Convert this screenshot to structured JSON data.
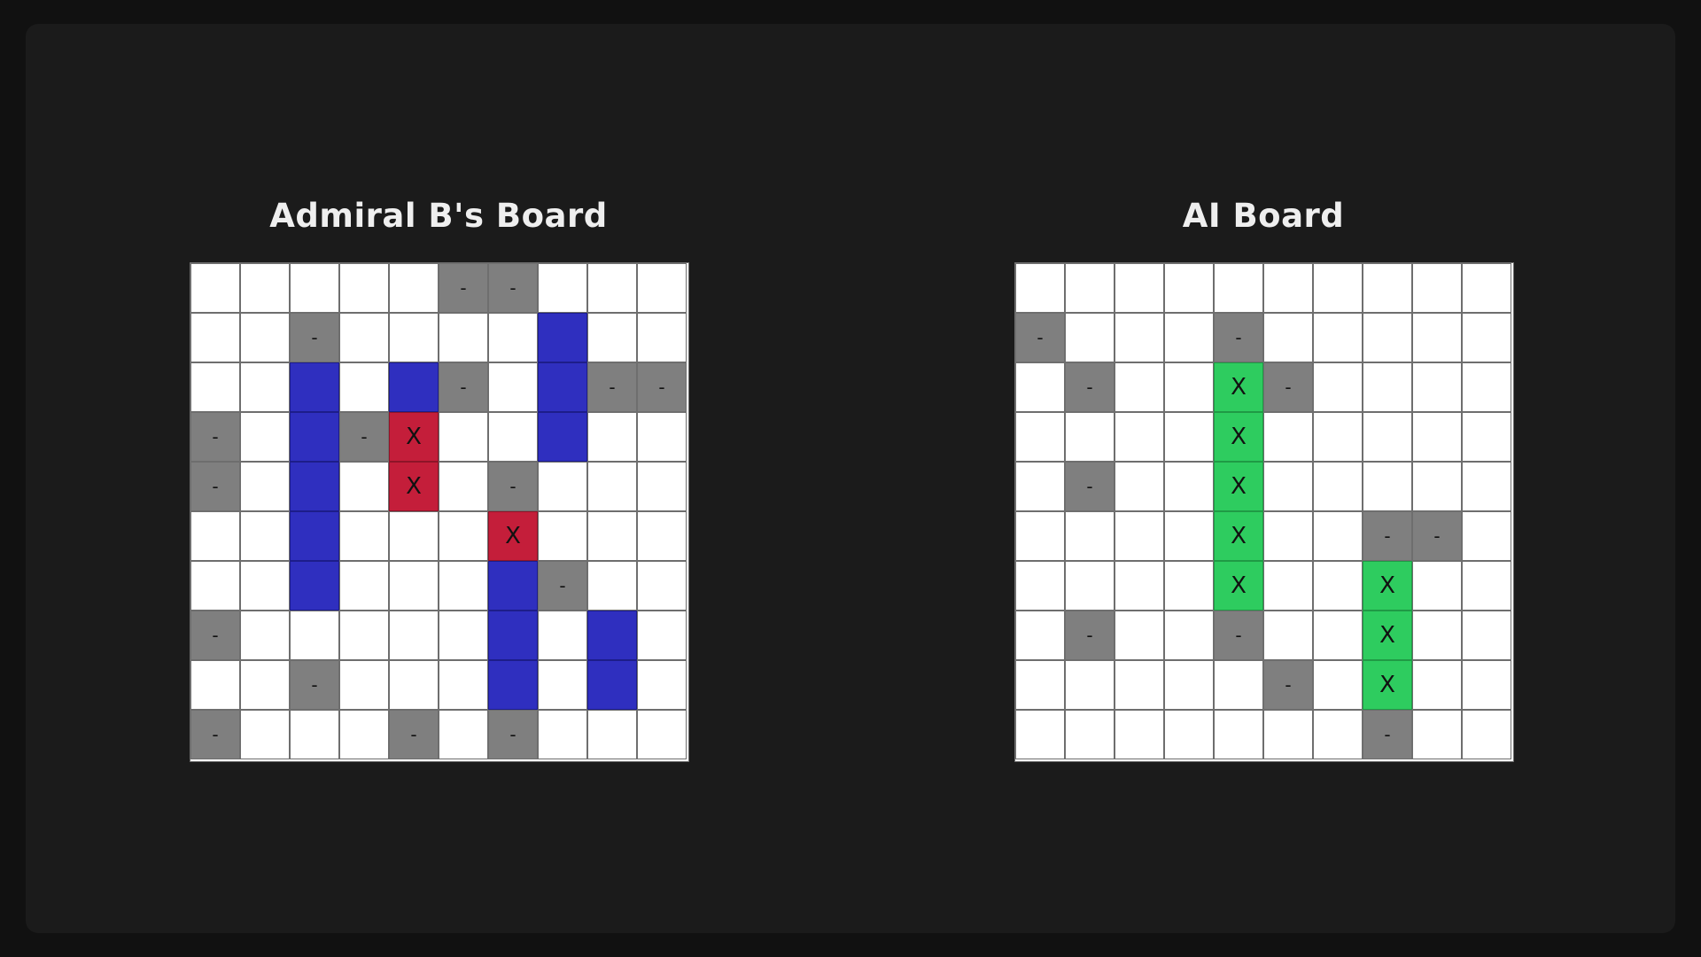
{
  "boards": [
    {
      "id": "player",
      "title": "Admiral B's Board",
      "legend": {
        ".": "empty",
        "S": "ship",
        "X": "hit",
        "-": "miss"
      },
      "rows": [
        ".....--...",
        "..-....S..",
        "..S.S-.S--",
        "-.S-X..S..",
        "-.S.X.-...",
        "..S...X...",
        "..S...S-..",
        "-.....S.S.",
        "..-...S.S.",
        "-...-.-..."
      ]
    },
    {
      "id": "ai",
      "title": "AI Board",
      "legend": {
        ".": "empty",
        "G": "sunk",
        "-": "miss"
      },
      "rows": [
        "..........",
        "-...-.....",
        ".-..G-....",
        "....G.....",
        ".-..G.....",
        "....G..--.",
        "....G..G..",
        ".-..-..G..",
        ".....-.G..",
        ".......-.."
      ]
    }
  ],
  "symbols": {
    "miss": "-",
    "hit": "X",
    "sunk": "X",
    "ship": "",
    "empty": ""
  },
  "colors": {
    "background": "#1b1b1b",
    "empty": "#ffffff",
    "miss": "#7f7f7f",
    "ship": "#2f2fbf",
    "hit": "#c41e3a",
    "sunk": "#2ecc5f",
    "title": "#efefef"
  }
}
